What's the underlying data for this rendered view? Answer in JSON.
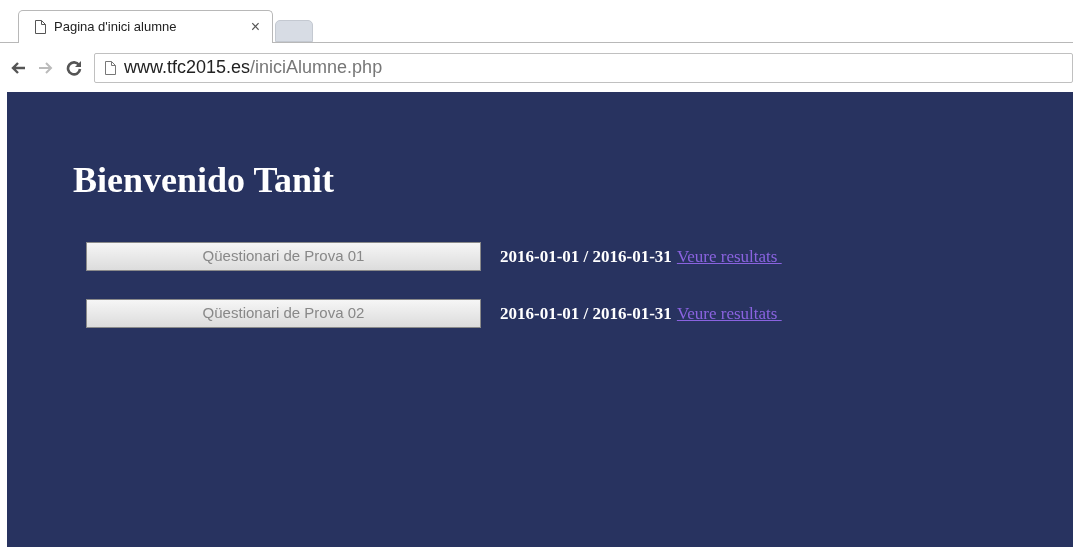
{
  "browser": {
    "tab_title": "Pagina d'inici alumne",
    "tab_close": "×",
    "url_host": "www.tfc2015.es",
    "url_path": "/iniciAlumne.php"
  },
  "page": {
    "heading": "Bienvenido Tanit",
    "quizzes": [
      {
        "label": "Qüestionari de Prova 01",
        "disabled": true,
        "dates": "2016-01-01 / 2016-01-31",
        "link": "Veure resultats "
      },
      {
        "label": "Qüestionari de Prova 02",
        "disabled": true,
        "dates": "2016-01-01 / 2016-01-31",
        "link": "Veure resultats "
      }
    ]
  }
}
